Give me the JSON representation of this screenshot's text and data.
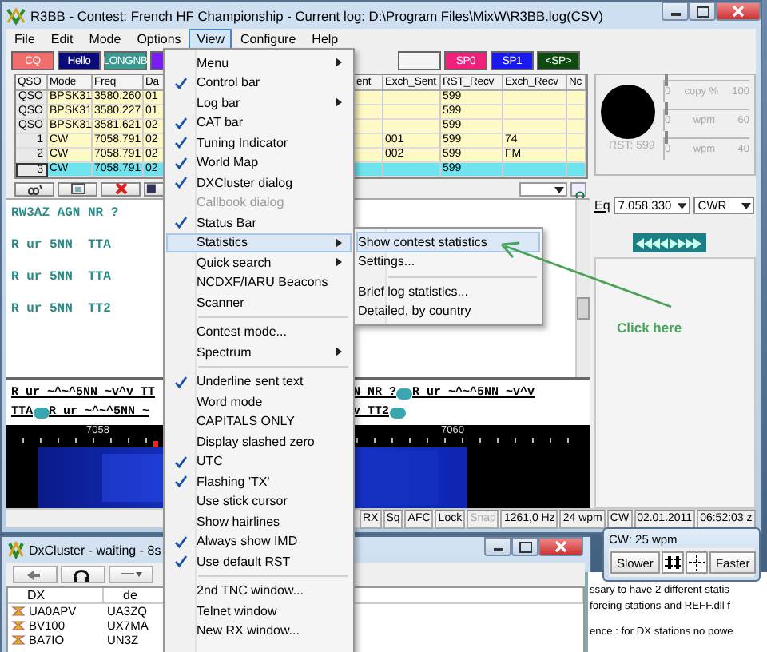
{
  "main_window": {
    "title": "R3BB - Contest: French HF Championship - Current log: D:\\Program Files\\MixW\\R3BB.log(CSV)",
    "menu_bar": [
      {
        "label": "File",
        "selected": false
      },
      {
        "label": "Edit",
        "selected": false
      },
      {
        "label": "Mode",
        "selected": false
      },
      {
        "label": "Options",
        "selected": false
      },
      {
        "label": "View",
        "selected": true
      },
      {
        "label": "Configure",
        "selected": false
      },
      {
        "label": "Help",
        "selected": false
      }
    ],
    "macro_buttons_left": [
      {
        "label": "CQ",
        "color": "#f26d6d"
      },
      {
        "label": "Hello",
        "color": "#0a0a7a"
      },
      {
        "label": "LONGNB",
        "color": "#3a9a90"
      },
      {
        "color": "#7a1cf0"
      }
    ],
    "macro_buttons_right": [
      {
        "color": "#f4f4f4"
      },
      {
        "label": "SP0",
        "color": "#f0207a"
      },
      {
        "label": "SP1",
        "color": "#1a1af0"
      },
      {
        "label": "<SP>",
        "color": "#104a10"
      }
    ],
    "log_table": {
      "columns": [
        "QSO",
        "Mode",
        "Freq",
        "Da",
        "ent",
        "Exch_Sent",
        "RST_Recv",
        "Exch_Recv",
        "Nc"
      ],
      "rows": [
        {
          "qso": "QSO",
          "mode": "BPSK31",
          "freq": "3580.260",
          "date": "01",
          "rst_recv": "599",
          "selected": false
        },
        {
          "qso": "QSO",
          "mode": "BPSK31",
          "freq": "3580.227",
          "date": "01",
          "rst_recv": "599",
          "selected": false
        },
        {
          "qso": "QSO",
          "mode": "BPSK31",
          "freq": "3581.621",
          "date": "02",
          "rst_recv": "599",
          "selected": false
        },
        {
          "qso": "1",
          "mode": "CW",
          "freq": "7058.791",
          "date": "02",
          "exch_sent": "001",
          "rst_recv": "599",
          "exch_recv": "74",
          "selected": false
        },
        {
          "qso": "2",
          "mode": "CW",
          "freq": "7058.791",
          "date": "02",
          "exch_sent": "002",
          "rst_recv": "599",
          "exch_recv": "FM",
          "selected": false
        },
        {
          "qso": "3",
          "mode": "CW",
          "freq": "7058.791",
          "date": "02",
          "rst_recv": "599",
          "selected": true
        }
      ]
    },
    "signal_panel": {
      "reading": "RST: 599",
      "sliders": [
        {
          "min": "0",
          "label": "copy %",
          "max": "100",
          "level": 0
        },
        {
          "min": "0",
          "label": "wpm",
          "max": "60",
          "level": 0
        },
        {
          "min": "0",
          "label": "wpm",
          "max": "40",
          "level": 0
        }
      ]
    },
    "rx_lines": [
      "RW3AZ AGN NR ?",
      "R ur 5NN  TTA",
      "R ur 5NN  TTA",
      "R ur 5NN  TT2"
    ],
    "tuning": {
      "eq_label": "Eq",
      "frequency": "7.058.330",
      "mode": "CWR"
    },
    "tx_lines": [
      {
        "left": [
          {
            "kind": "text",
            "text": "R ur ~^~^5NN ~v^v TT"
          }
        ],
        "right": [
          {
            "kind": "text",
            "text": "N NR ?"
          },
          {
            "kind": "badge"
          },
          {
            "kind": "text",
            "text": "R ur ~^~^5NN ~v^v"
          }
        ]
      },
      {
        "left": [
          {
            "kind": "text",
            "text": "TTA"
          },
          {
            "kind": "badge"
          },
          {
            "kind": "text",
            "text": "R ur ~^~^5NN ~"
          }
        ],
        "right": [
          {
            "kind": "text",
            "text": "v TT2"
          },
          {
            "kind": "badge"
          }
        ]
      }
    ],
    "waterfall": {
      "scale": [
        "7058",
        "7060"
      ]
    },
    "status_bar": [
      {
        "text": "RX",
        "disabled": false
      },
      {
        "text": "Sq",
        "disabled": false
      },
      {
        "text": "AFC",
        "disabled": false
      },
      {
        "text": "Lock",
        "disabled": false
      },
      {
        "text": "Snap",
        "disabled": true
      },
      {
        "text": "1261,0 Hz",
        "disabled": false
      },
      {
        "text": "24 wpm",
        "disabled": false
      },
      {
        "text": "CW",
        "disabled": false
      },
      {
        "text": "02.01.2011",
        "disabled": false
      },
      {
        "text": "06:52:03 z",
        "disabled": false
      }
    ]
  },
  "dx_cluster": {
    "title": "DxCluster - waiting - 8s",
    "columns": [
      "DX",
      "de"
    ],
    "rows": [
      {
        "dx": "UA0APV",
        "de": "UA3ZQ"
      },
      {
        "dx": "BV100",
        "de": "UX7MA"
      },
      {
        "dx": "BA7IO",
        "de": "UN3Z"
      }
    ]
  },
  "note_window": {
    "paragraphs": [
      [
        "ssary to have 2 different statis",
        "foreing stations and REFF.dll f"
      ],
      [
        "ence : for DX stations no powe"
      ]
    ]
  },
  "cw_window": {
    "title": "CW: 25 wpm",
    "slower": "Slower",
    "faster": "Faster"
  },
  "view_menu": {
    "items": [
      {
        "kind": "submenu",
        "label": "Menu",
        "checked": false,
        "selected": false,
        "disabled": false
      },
      {
        "kind": "item",
        "label": "Control bar",
        "checked": true,
        "selected": false,
        "disabled": false
      },
      {
        "kind": "submenu",
        "label": "Log bar",
        "checked": false,
        "selected": false,
        "disabled": false
      },
      {
        "kind": "item",
        "label": "CAT bar",
        "checked": true,
        "selected": false,
        "disabled": false
      },
      {
        "kind": "item",
        "label": "Tuning Indicator",
        "checked": true,
        "selected": false,
        "disabled": false
      },
      {
        "kind": "item",
        "label": "World Map",
        "checked": true,
        "selected": false,
        "disabled": false
      },
      {
        "kind": "item",
        "label": "DXCluster dialog",
        "checked": true,
        "selected": false,
        "disabled": false
      },
      {
        "kind": "item",
        "label": "Callbook dialog",
        "checked": false,
        "selected": false,
        "disabled": true
      },
      {
        "kind": "item",
        "label": "Status Bar",
        "checked": true,
        "selected": false,
        "disabled": false
      },
      {
        "kind": "submenu",
        "label": "Statistics",
        "checked": false,
        "selected": true,
        "disabled": false
      },
      {
        "kind": "submenu",
        "label": "Quick search",
        "checked": false,
        "selected": false,
        "disabled": false
      },
      {
        "kind": "item",
        "label": "NCDXF/IARU Beacons",
        "checked": false,
        "selected": false,
        "disabled": false
      },
      {
        "kind": "item",
        "label": "Scanner",
        "checked": false,
        "selected": false,
        "disabled": false
      },
      {
        "kind": "separator"
      },
      {
        "kind": "item",
        "label": "Contest mode...",
        "checked": false,
        "selected": false,
        "disabled": false
      },
      {
        "kind": "submenu",
        "label": "Spectrum",
        "checked": false,
        "selected": false,
        "disabled": false
      },
      {
        "kind": "separator"
      },
      {
        "kind": "item",
        "label": "Underline sent text",
        "checked": true,
        "selected": false,
        "disabled": false
      },
      {
        "kind": "item",
        "label": "Word mode",
        "checked": false,
        "selected": false,
        "disabled": false
      },
      {
        "kind": "item",
        "label": "CAPITALS ONLY",
        "checked": false,
        "selected": false,
        "disabled": false
      },
      {
        "kind": "item",
        "label": "Display slashed zero",
        "checked": false,
        "selected": false,
        "disabled": false
      },
      {
        "kind": "item",
        "label": "UTC",
        "checked": true,
        "selected": false,
        "disabled": false
      },
      {
        "kind": "item",
        "label": "Flashing 'TX'",
        "checked": true,
        "selected": false,
        "disabled": false
      },
      {
        "kind": "item",
        "label": "Use stick cursor",
        "checked": false,
        "selected": false,
        "disabled": false
      },
      {
        "kind": "item",
        "label": "Show hairlines",
        "checked": false,
        "selected": false,
        "disabled": false
      },
      {
        "kind": "item",
        "label": "Always show IMD",
        "checked": true,
        "selected": false,
        "disabled": false
      },
      {
        "kind": "item",
        "label": "Use default RST",
        "checked": true,
        "selected": false,
        "disabled": false
      },
      {
        "kind": "separator"
      },
      {
        "kind": "item",
        "label": "2nd TNC window...",
        "checked": false,
        "selected": false,
        "disabled": false
      },
      {
        "kind": "item",
        "label": "Telnet window",
        "checked": false,
        "selected": false,
        "disabled": false
      },
      {
        "kind": "item",
        "label": "New RX window...",
        "checked": false,
        "selected": false,
        "disabled": false
      }
    ]
  },
  "statistics_submenu": {
    "items": [
      {
        "kind": "item",
        "label": "Show contest statistics",
        "selected": true
      },
      {
        "kind": "item",
        "label": "Settings...",
        "selected": false
      },
      {
        "kind": "separator"
      },
      {
        "kind": "item",
        "label": "Brief log statistics...",
        "selected": false
      },
      {
        "kind": "item",
        "label": "Detailed, by country",
        "selected": false
      }
    ]
  },
  "annotation": {
    "text": "Click here"
  }
}
